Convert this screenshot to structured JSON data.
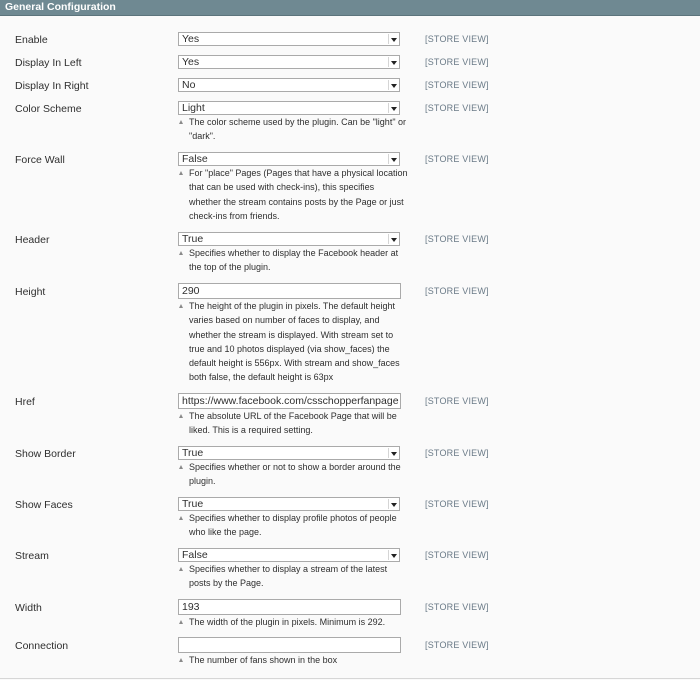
{
  "section": {
    "title": "General Configuration"
  },
  "scope_label": "[STORE VIEW]",
  "fields": {
    "enable": {
      "label": "Enable",
      "value": "Yes"
    },
    "display_in_left": {
      "label": "Display In Left",
      "value": "Yes"
    },
    "display_in_right": {
      "label": "Display In Right",
      "value": "No"
    },
    "color_scheme": {
      "label": "Color Scheme",
      "value": "Light",
      "note": "The color scheme used by the plugin. Can be \"light\" or \"dark\"."
    },
    "force_wall": {
      "label": "Force Wall",
      "value": "False",
      "note": "For \"place\" Pages (Pages that have a physical location that can be used with check-ins), this specifies whether the stream contains posts by the Page or just check-ins from friends."
    },
    "header": {
      "label": "Header",
      "value": "True",
      "note": "Specifies whether to display the Facebook header at the top of the plugin."
    },
    "height": {
      "label": "Height",
      "value": "290",
      "note": "The height of the plugin in pixels. The default height varies based on number of faces to display, and whether the stream is displayed. With stream set to true and 10 photos displayed (via show_faces) the default height is 556px. With stream and show_faces both false, the default height is 63px"
    },
    "href": {
      "label": "Href",
      "value": "https://www.facebook.com/csschopperfanpage",
      "note": "The absolute URL of the Facebook Page that will be liked. This is a required setting."
    },
    "show_border": {
      "label": "Show Border",
      "value": "True",
      "note": "Specifies whether or not to show a border around the plugin."
    },
    "show_faces": {
      "label": "Show Faces",
      "value": "True",
      "note": "Specifies whether to display profile photos of people who like the page."
    },
    "stream": {
      "label": "Stream",
      "value": "False",
      "note": "Specifies whether to display a stream of the latest posts by the Page."
    },
    "width": {
      "label": "Width",
      "value": "193",
      "note": "The width of the plugin in pixels. Minimum is 292."
    },
    "connection": {
      "label": "Connection",
      "value": "",
      "note": "The number of fans shown in the box"
    }
  }
}
